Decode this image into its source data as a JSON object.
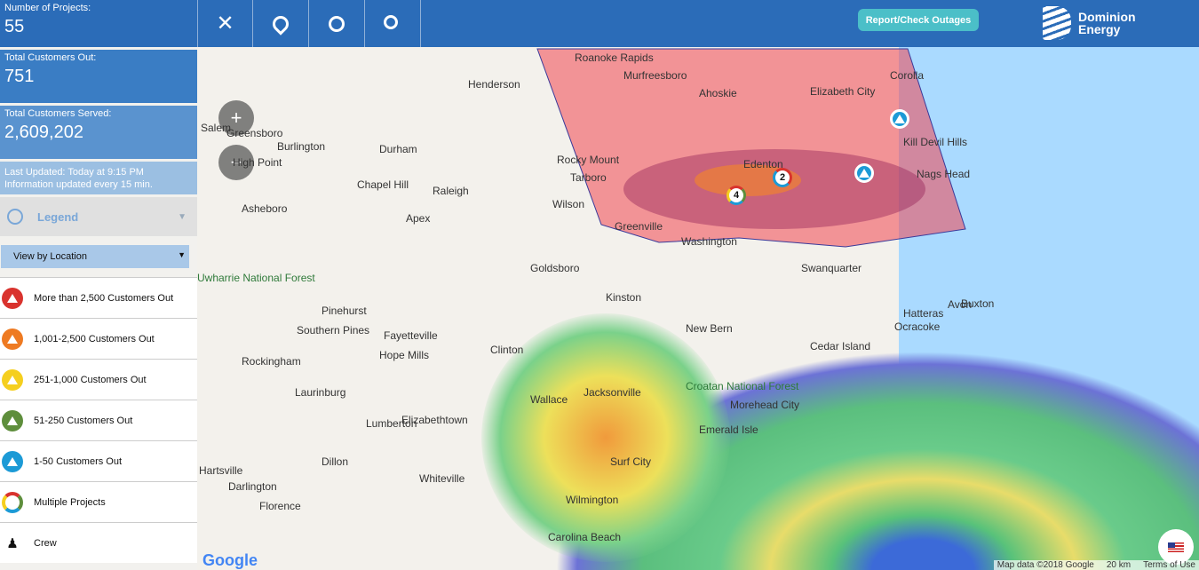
{
  "stats": {
    "projects_label": "Number of Projects:",
    "projects_value": "55",
    "out_label": "Total Customers Out:",
    "out_value": "751",
    "served_label": "Total Customers Served:",
    "served_value": "2,609,202",
    "updated": "Last Updated: Today at 9:15 PM",
    "frequency": "Information updated every 15 min."
  },
  "legend": {
    "title": "Legend",
    "view_select": "View by Location",
    "items": [
      {
        "label": "More than 2,500 Customers Out",
        "color": "#d9332e"
      },
      {
        "label": "1,001-2,500 Customers Out",
        "color": "#ee7a22"
      },
      {
        "label": "251-1,000 Customers Out",
        "color": "#f5cf1f"
      },
      {
        "label": "51-250 Customers Out",
        "color": "#5e8e3c"
      },
      {
        "label": "1-50 Customers Out",
        "color": "#1c9ad6"
      },
      {
        "label": "Multiple Projects"
      },
      {
        "label": "Crew"
      }
    ]
  },
  "toolbar": {
    "close": "✕",
    "locate_person": "⚲",
    "target": "⌖",
    "search": "⚲"
  },
  "header": {
    "report_button": "Report/Check Outages",
    "logo_line1": "Dominion",
    "logo_line2": "Energy"
  },
  "map": {
    "zoom_in": "+",
    "zoom_out": "−",
    "cities": [
      "Greensboro",
      "Burlington",
      "Durham",
      "Chapel Hill",
      "Raleigh",
      "Rocky Mount",
      "Tarboro",
      "Wilson",
      "Henderson",
      "Asheboro",
      "Apex",
      "Goldsboro",
      "Fayetteville",
      "Hope Mills",
      "Pinehurst",
      "Southern Pines",
      "Rockingham",
      "Laurinburg",
      "Lumberton",
      "Elizabethtown",
      "Clinton",
      "Jacksonville",
      "Wilmington",
      "Florence",
      "Dillon",
      "Whiteville",
      "Hartsville",
      "Darlington",
      "Uwharrie National Forest",
      "Croatan National Forest",
      "New Bern",
      "Kinston",
      "Greenville",
      "Washington",
      "Edenton",
      "Elizabeth City",
      "Ahoskie",
      "Murfreesboro",
      "Nags Head",
      "Corolla",
      "Hatteras",
      "Avon",
      "Buxton",
      "Ocracoke",
      "Morehead City",
      "Emerald Isle",
      "Surf City",
      "Carolina Beach",
      "High Point",
      "Salem",
      "Roanoke Rapids",
      "Kill Devil Hills",
      "Swanquarter",
      "Cedar Island",
      "Wallace"
    ],
    "markers": [
      {
        "label": "4",
        "color": "#d9332e"
      },
      {
        "label": "2",
        "color": "#d9332e"
      },
      {
        "label": "",
        "color": "#1c9ad6"
      },
      {
        "label": "",
        "color": "#1c9ad6"
      }
    ],
    "attribution": "Map data ©2018 Google",
    "scale": "20 km",
    "terms": "Terms of Use",
    "google_logo": "Google"
  }
}
